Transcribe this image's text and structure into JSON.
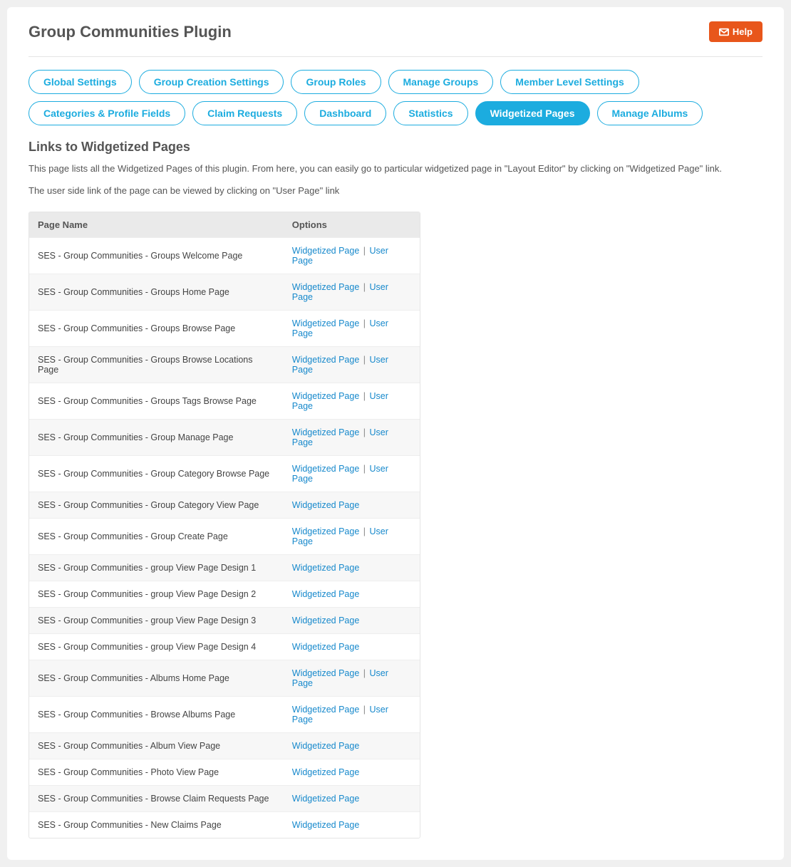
{
  "header": {
    "title": "Group Communities Plugin",
    "help_label": "Help"
  },
  "tabs": [
    {
      "label": "Global Settings",
      "active": false
    },
    {
      "label": "Group Creation Settings",
      "active": false
    },
    {
      "label": "Group Roles",
      "active": false
    },
    {
      "label": "Manage Groups",
      "active": false
    },
    {
      "label": "Member Level Settings",
      "active": false
    },
    {
      "label": "Categories & Profile Fields",
      "active": false
    },
    {
      "label": "Claim Requests",
      "active": false
    },
    {
      "label": "Dashboard",
      "active": false
    },
    {
      "label": "Statistics",
      "active": false
    },
    {
      "label": "Widgetized Pages",
      "active": true
    },
    {
      "label": "Manage Albums",
      "active": false
    }
  ],
  "section": {
    "title": "Links to Widgetized Pages",
    "desc1": "This page lists all the Widgetized Pages of this plugin. From here, you can easily go to particular widgetized page in \"Layout Editor\" by clicking on \"Widgetized Page\" link.",
    "desc2": "The user side link of the page can be viewed by clicking on \"User Page\" link"
  },
  "table": {
    "columns": {
      "page_name": "Page Name",
      "options": "Options"
    },
    "widgetized_label": "Widgetized Page",
    "user_label": "User Page",
    "sep": "|",
    "rows": [
      {
        "name": "SES - Group Communities - Groups Welcome Page",
        "user": true
      },
      {
        "name": "SES - Group Communities - Groups Home Page",
        "user": true
      },
      {
        "name": "SES - Group Communities - Groups Browse Page",
        "user": true
      },
      {
        "name": "SES - Group Communities - Groups Browse Locations Page",
        "user": true
      },
      {
        "name": "SES - Group Communities - Groups Tags Browse Page",
        "user": true
      },
      {
        "name": "SES - Group Communities - Group Manage Page",
        "user": true
      },
      {
        "name": "SES - Group Communities - Group Category Browse Page",
        "user": true
      },
      {
        "name": "SES - Group Communities - Group Category View Page",
        "user": false
      },
      {
        "name": "SES - Group Communities - Group Create Page",
        "user": true
      },
      {
        "name": "SES - Group Communities - group View Page Design 1",
        "user": false
      },
      {
        "name": "SES - Group Communities - group View Page Design 2",
        "user": false
      },
      {
        "name": "SES - Group Communities - group View Page Design 3",
        "user": false
      },
      {
        "name": "SES - Group Communities - group View Page Design 4",
        "user": false
      },
      {
        "name": "SES - Group Communities - Albums Home Page",
        "user": true
      },
      {
        "name": "SES - Group Communities - Browse Albums Page",
        "user": true
      },
      {
        "name": "SES - Group Communities - Album View Page",
        "user": false
      },
      {
        "name": "SES - Group Communities - Photo View Page",
        "user": false
      },
      {
        "name": "SES - Group Communities - Browse Claim Requests Page",
        "user": false
      },
      {
        "name": "SES - Group Communities - New Claims Page",
        "user": false
      }
    ]
  }
}
